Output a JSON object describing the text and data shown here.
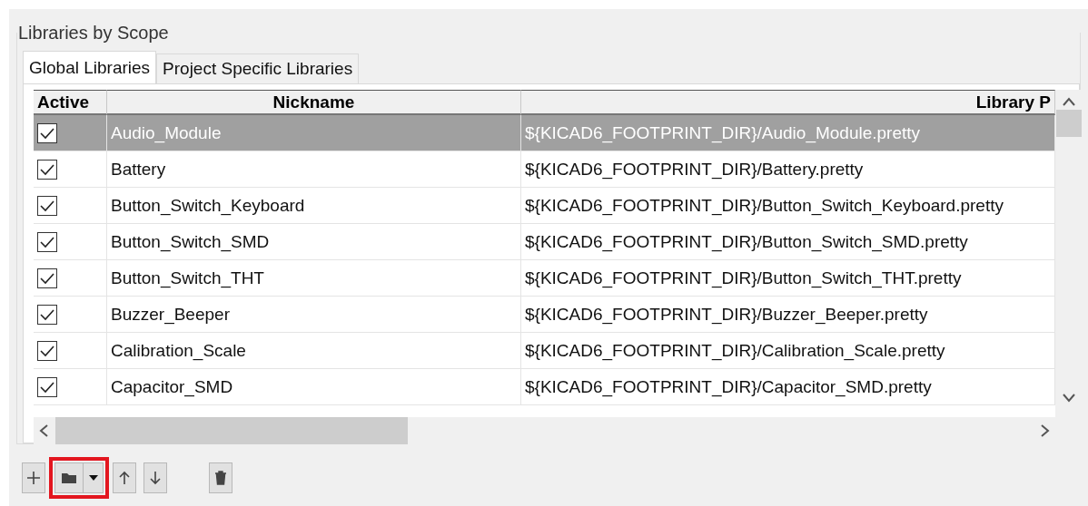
{
  "group": {
    "title": "Libraries by Scope"
  },
  "tabs": [
    {
      "label": "Global Libraries",
      "selected": true
    },
    {
      "label": "Project Specific Libraries",
      "selected": false
    }
  ],
  "table": {
    "columns": [
      "Active",
      "Nickname",
      "Library P"
    ],
    "rows": [
      {
        "active": true,
        "selected": true,
        "nickname": "Audio_Module",
        "path": "${KICAD6_FOOTPRINT_DIR}/Audio_Module.pretty"
      },
      {
        "active": true,
        "selected": false,
        "nickname": "Battery",
        "path": "${KICAD6_FOOTPRINT_DIR}/Battery.pretty"
      },
      {
        "active": true,
        "selected": false,
        "nickname": "Button_Switch_Keyboard",
        "path": "${KICAD6_FOOTPRINT_DIR}/Button_Switch_Keyboard.pretty"
      },
      {
        "active": true,
        "selected": false,
        "nickname": "Button_Switch_SMD",
        "path": "${KICAD6_FOOTPRINT_DIR}/Button_Switch_SMD.pretty"
      },
      {
        "active": true,
        "selected": false,
        "nickname": "Button_Switch_THT",
        "path": "${KICAD6_FOOTPRINT_DIR}/Button_Switch_THT.pretty"
      },
      {
        "active": true,
        "selected": false,
        "nickname": "Buzzer_Beeper",
        "path": "${KICAD6_FOOTPRINT_DIR}/Buzzer_Beeper.pretty"
      },
      {
        "active": true,
        "selected": false,
        "nickname": "Calibration_Scale",
        "path": "${KICAD6_FOOTPRINT_DIR}/Calibration_Scale.pretty"
      },
      {
        "active": true,
        "selected": false,
        "nickname": "Capacitor_SMD",
        "path": "${KICAD6_FOOTPRINT_DIR}/Capacitor_SMD.pretty"
      }
    ]
  },
  "toolbar": [
    {
      "kind": "add"
    },
    {
      "kind": "folder",
      "highlighted": true
    },
    {
      "kind": "up"
    },
    {
      "kind": "down"
    },
    {
      "kind": "gap"
    },
    {
      "kind": "delete"
    }
  ]
}
